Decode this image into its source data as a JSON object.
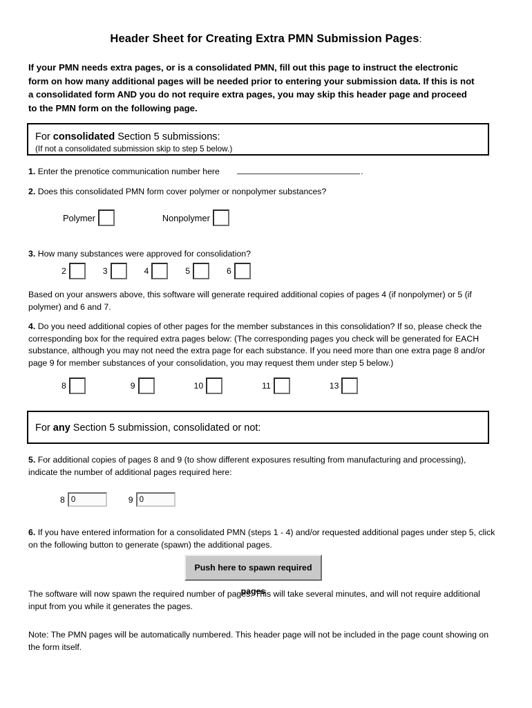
{
  "document": {
    "title_main": "Header Sheet for Creating Extra PMN Submission Pages",
    "title_colon": ":",
    "intro": "If your PMN needs extra pages, or is a consolidated PMN, fill out this page to instruct the electronic form on how many additional pages will be needed prior to entering your submission data.  If this is not a consolidated form AND you do not require extra pages, you may skip this header page and proceed to the PMN form on the following page."
  },
  "section_consolidated": {
    "heading_prefix": "For ",
    "heading_bold": "consolidated",
    "heading_suffix": " Section 5 submissions:",
    "subnote": "(If not a consolidated submission skip to step 5 below.)"
  },
  "question1": {
    "number": "1.",
    "text": "Enter the prenotice communication number here",
    "trailing": "."
  },
  "question2": {
    "number": "2.",
    "text": "Does this consolidated PMN form cover polymer or nonpolymer substances?",
    "options": [
      {
        "label": "Polymer",
        "checked": false
      },
      {
        "label": "Nonpolymer",
        "checked": false
      }
    ]
  },
  "question3": {
    "number": "3.",
    "text": "How many substances were approved for consolidation?",
    "options": [
      {
        "label": "2",
        "checked": false
      },
      {
        "label": "3",
        "checked": false
      },
      {
        "label": "4",
        "checked": false
      },
      {
        "label": "5",
        "checked": false
      },
      {
        "label": "6",
        "checked": false
      }
    ]
  },
  "note_generate": "Based on your answers above, this software will generate required additional copies of pages 4 (if nonpolymer) or 5 (if polymer) and 6 and 7.",
  "question4": {
    "number": "4.",
    "text": "Do you need additional copies of other pages for the member substances in this consolidation?  If so, please check the corresponding box for the required extra pages below:  (The corresponding pages you check will be generated for EACH substance, although you may not need the extra page for each substance.  If you need more than one extra page 8 and/or page 9 for member substances of your consolidation, you may request them under step 5 below.)",
    "options": [
      {
        "label": "8",
        "checked": false
      },
      {
        "label": "9",
        "checked": false
      },
      {
        "label": "10",
        "checked": false
      },
      {
        "label": "11",
        "checked": false
      },
      {
        "label": "13",
        "checked": false
      }
    ]
  },
  "section_any": {
    "heading_prefix": "For ",
    "heading_bold": "any",
    "heading_suffix": " Section 5 submission, consolidated or not:"
  },
  "question5": {
    "number": "5.",
    "text": "For additional copies of pages 8 and 9 (to show different exposures resulting from manufacturing and processing), indicate the number of additional pages required here:",
    "fields": [
      {
        "label": "8",
        "value": "0"
      },
      {
        "label": "9",
        "value": "0"
      }
    ]
  },
  "question6": {
    "number": "6.",
    "text": "If you have entered information for a consolidated PMN (steps 1 - 4) and/or requested additional pages under step 5, click on the following button to generate (spawn) the additional pages.",
    "button_label": "Push here to spawn required pages"
  },
  "closing": {
    "spawn_note": "The software will now spawn the required number of pages.  This will take several minutes, and will not require additional input from you while it generates the pages.",
    "page_note": "Note: The PMN pages will be automatically numbered. This header page will not be included in the page count showing on the form itself."
  },
  "colors": {
    "button_face": "#c9c9c9",
    "border": "#000000",
    "field_bg": "#ffffff"
  }
}
